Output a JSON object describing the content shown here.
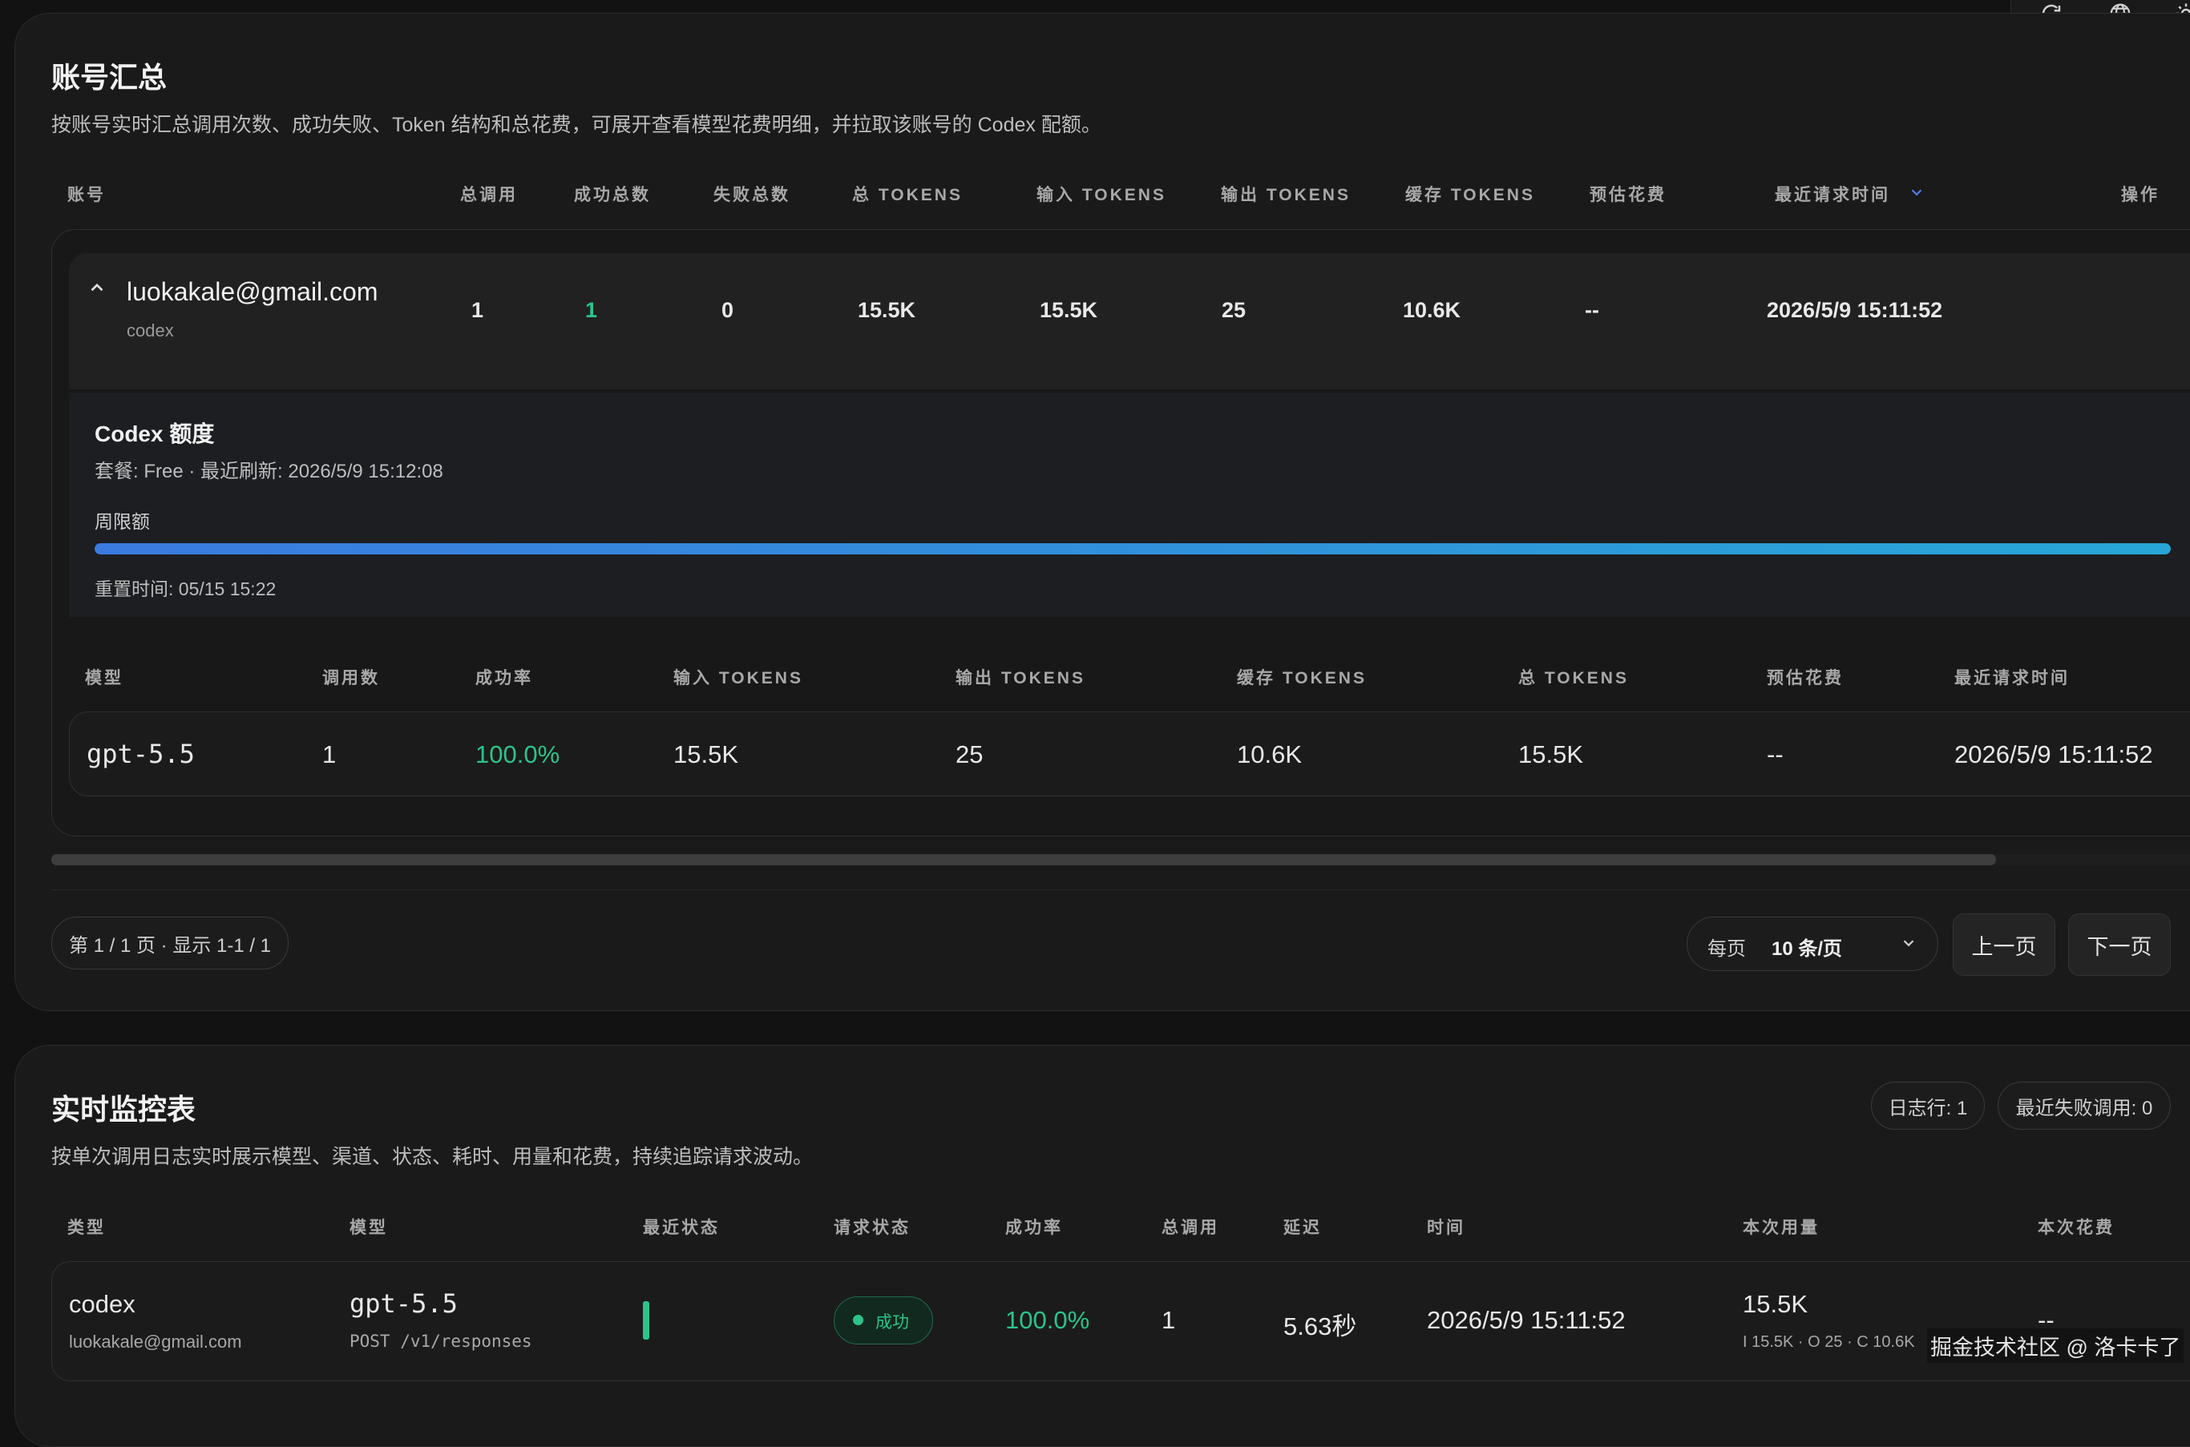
{
  "top_toolbar": {
    "refresh_icon": "refresh-icon",
    "globe_icon": "globe-icon",
    "theme_icon": "sun-icon"
  },
  "accounts_section": {
    "title": "账号汇总",
    "description": "按账号实时汇总调用次数、成功失败、Token 结构和总花费，可展开查看模型花费明细，并拉取该账号的 Codex 配额。",
    "columns": [
      "账号",
      "总调用",
      "成功总数",
      "失败总数",
      "总 TOKENS",
      "输入 TOKENS",
      "输出 TOKENS",
      "缓存 TOKENS",
      "预估花费",
      "最近请求时间",
      "操作"
    ],
    "account": {
      "email": "luokakale@gmail.com",
      "channel": "codex",
      "total_calls": "1",
      "success": "1",
      "failed": "0",
      "total_tokens": "15.5K",
      "input_tokens": "15.5K",
      "output_tokens": "25",
      "cache_tokens": "10.6K",
      "cost": "--",
      "last_request": "2026/5/9 15:11:52"
    },
    "quota": {
      "title": "Codex 额度",
      "meta": "套餐: Free · 最近刷新: 2026/5/9 15:12:08",
      "limit_label": "周限额",
      "progress": 1.0,
      "reset": "重置时间: 05/15 15:22"
    },
    "model_columns": [
      "模型",
      "调用数",
      "成功率",
      "输入 TOKENS",
      "输出 TOKENS",
      "缓存 TOKENS",
      "总 TOKENS",
      "预估花费",
      "最近请求时间"
    ],
    "model_row": {
      "model": "gpt-5.5",
      "calls": "1",
      "success_rate": "100.0%",
      "input_tokens": "15.5K",
      "output_tokens": "25",
      "cache_tokens": "10.6K",
      "total_tokens": "15.5K",
      "cost": "--",
      "last_request": "2026/5/9 15:11:52"
    },
    "pagination": {
      "info": "第 1 / 1 页 · 显示 1-1 / 1",
      "per_page_label": "每页",
      "per_page_value": "10 条/页",
      "prev": "上一页",
      "next": "下一页"
    }
  },
  "monitor_section": {
    "title": "实时监控表",
    "description": "按单次调用日志实时展示模型、渠道、状态、耗时、用量和花费，持续追踪请求波动。",
    "badges": {
      "log_rows": "日志行: 1",
      "recent_failed": "最近失败调用: 0"
    },
    "columns": [
      "类型",
      "模型",
      "最近状态",
      "请求状态",
      "成功率",
      "总调用",
      "延迟",
      "时间",
      "本次用量",
      "本次花费"
    ],
    "row": {
      "type": "codex",
      "account": "luokakale@gmail.com",
      "model": "gpt-5.5",
      "endpoint": "POST /v1/responses",
      "request_status": "成功",
      "success_rate": "100.0%",
      "total_calls": "1",
      "latency": "5.63秒",
      "time": "2026/5/9 15:11:52",
      "usage": "15.5K",
      "usage_detail": "I 15.5K · O 25 · C 10.6K",
      "cost": "--"
    }
  },
  "watermark": "掘金技术社区 @ 洛卡卡了",
  "colors": {
    "success": "#2bc48a",
    "progress_start": "#3b7be0",
    "progress_end": "#27a6d6"
  }
}
